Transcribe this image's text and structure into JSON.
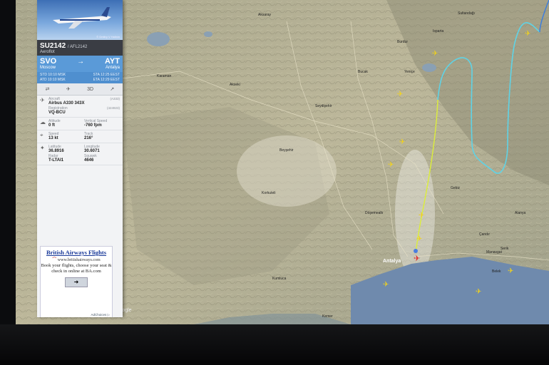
{
  "flight": {
    "number": "SU2142",
    "icao": "/ AFL2142",
    "airline": "Aeroflot",
    "photo_credit": "© Dmitry V Halinin",
    "origin_code": "SVO",
    "origin_city": "Moscow",
    "destination_code": "AYT",
    "destination_city": "Antalya",
    "std": "10:10 MSK",
    "atd": "10:10 MSK",
    "sta": "12:25 EEST",
    "eta": "12:29 EEST",
    "std_label": "STD",
    "atd_label": "ATD",
    "sta_label": "STA",
    "eta_label": "ETA"
  },
  "tools": [
    "3D"
  ],
  "details": {
    "aircraft_label": "Aircraft",
    "aircraft": "Airbus A330 343X",
    "aircraft_code": "(A333)",
    "registration_label": "Registration",
    "registration": "VQ-BCU",
    "registration_code": "(424923)",
    "altitude_label": "Altitude",
    "altitude": "0 ft",
    "vspeed_label": "Vertical Speed",
    "vspeed": "-760 fpm",
    "speed_label": "Speed",
    "speed": "13 kt",
    "track_label": "Track",
    "track": "216°",
    "lat_label": "Latitude",
    "lat": "36.8916",
    "lon_label": "Longitude",
    "lon": "30.6071",
    "radar_label": "Radar",
    "radar": "T-LTAI1",
    "squawk_label": "Squawk",
    "squawk": "4646"
  },
  "ad": {
    "title": "British Airways Flights",
    "url": "www.britishairways.com",
    "body": "Book your flights, choose your seat & check in online at BA.com",
    "button": "➜",
    "choices": "AdChoices ▷"
  },
  "map": {
    "attribution": "Google",
    "city": "Antalya",
    "labels": [
      "Karaman",
      "Aksaray",
      "Beyşehir",
      "Seydişehir",
      "Isparta",
      "Burdur",
      "Bucak",
      "Manavgat",
      "Alanya",
      "Serik",
      "Belek",
      "Kemer",
      "Çandır",
      "Sultandağı",
      "Gebiz",
      "Döşemealtı",
      "Korkuteli",
      "Kumluca",
      "Yeniçe",
      "Akseki"
    ],
    "route_colors": {
      "track": "#5fd3e6",
      "approach": "#3a7de0",
      "ground": "#dcee3a"
    },
    "sea_color": "#6f8aad",
    "land_color": "#b9b394"
  }
}
